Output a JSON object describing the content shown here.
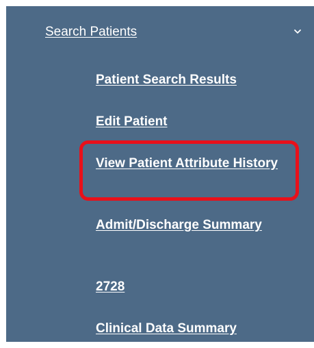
{
  "nav": {
    "parent_label": "Search Patients",
    "parent_expanded": true,
    "chevron_icon": "chevron-down-icon",
    "items": [
      {
        "label": "Patient Search Results"
      },
      {
        "label": "Edit Patient"
      },
      {
        "label": "View Patient Attribute History",
        "highlighted": true
      },
      {
        "label": "Admit/Discharge Summary"
      },
      {
        "label": "2728"
      },
      {
        "label": "Clinical Data Summary"
      }
    ]
  },
  "colors": {
    "panel_background": "#4d6a87",
    "text": "#ffffff",
    "highlight_border": "#e8101a"
  }
}
